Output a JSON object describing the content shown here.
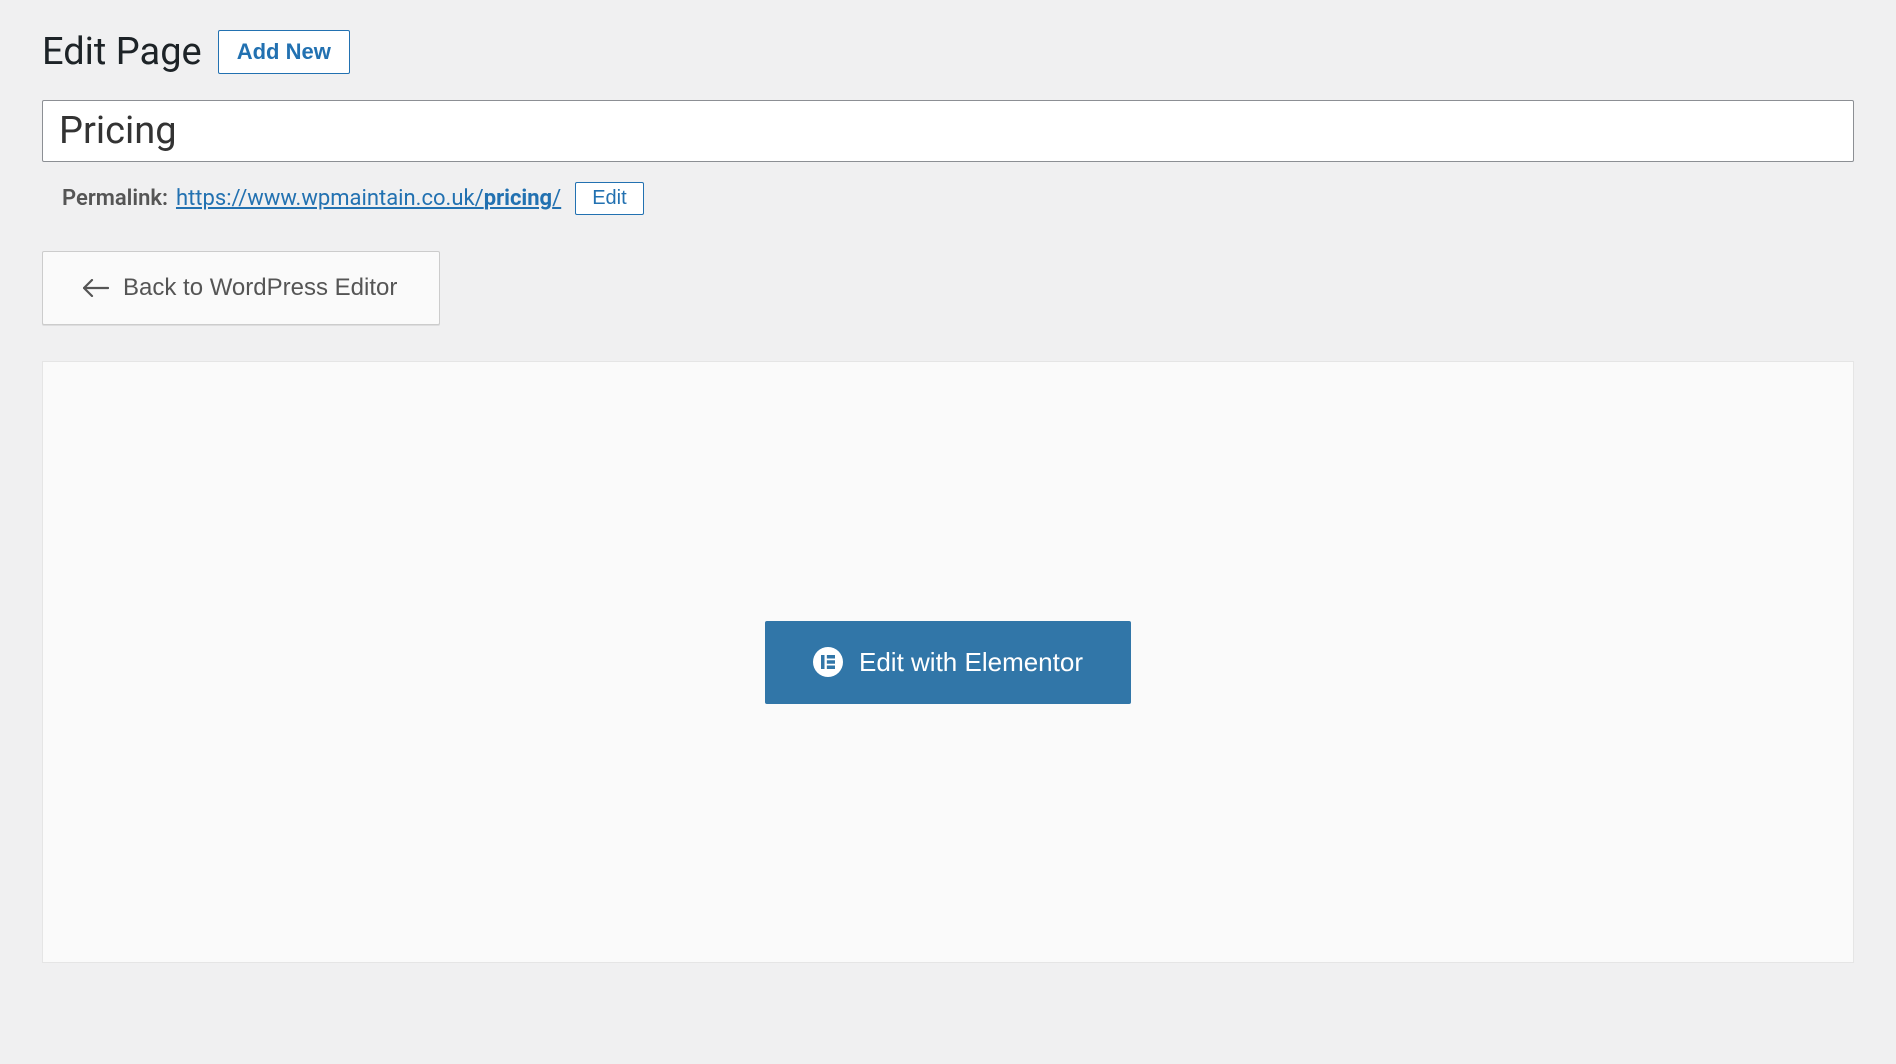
{
  "header": {
    "title": "Edit Page",
    "add_new_label": "Add New"
  },
  "page": {
    "title_value": "Pricing"
  },
  "permalink": {
    "label": "Permalink:",
    "url_base": "https://www.wpmaintain.co.uk/",
    "slug": "pricing",
    "trailing": "/",
    "edit_label": "Edit"
  },
  "actions": {
    "back_label": "Back to WordPress Editor",
    "elementor_label": "Edit with Elementor"
  }
}
